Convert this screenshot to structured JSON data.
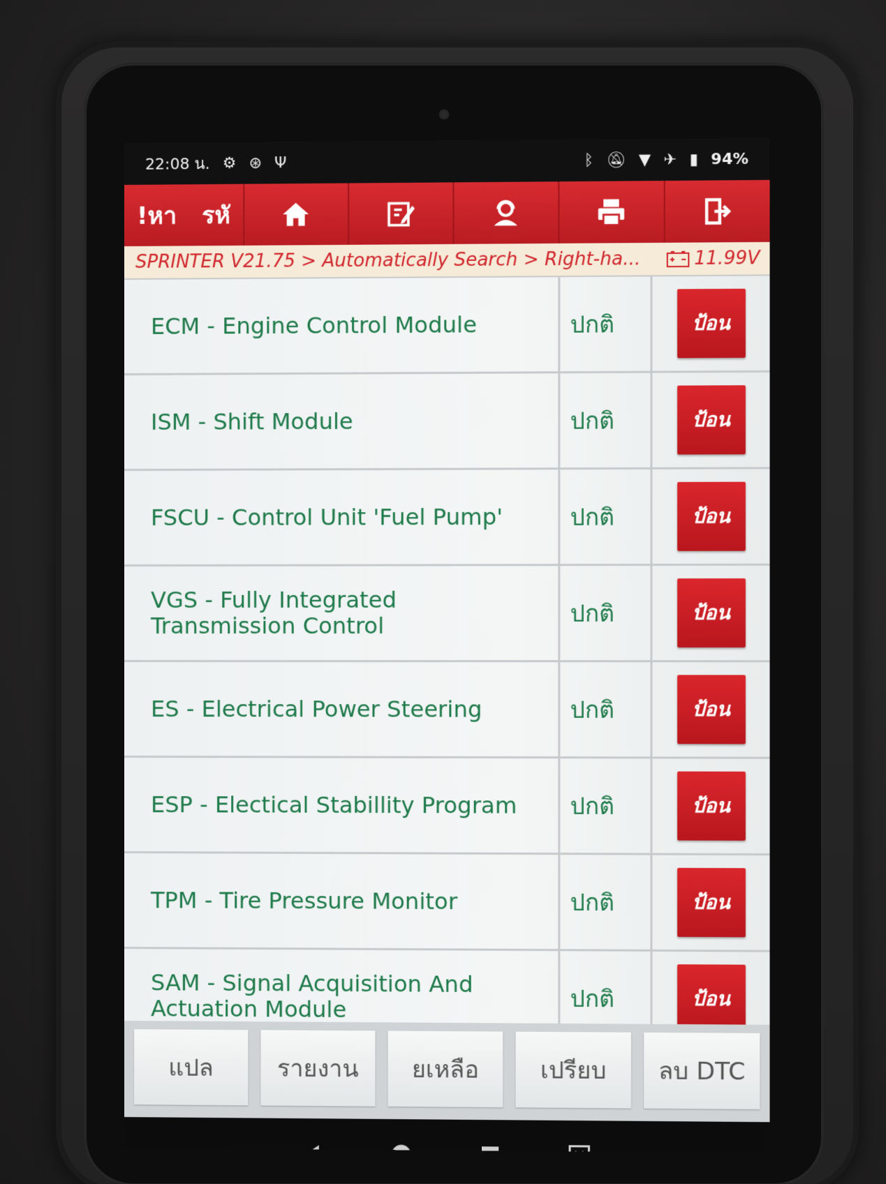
{
  "status_bar": {
    "time": "22:08 น.",
    "battery": "94%",
    "icons_left": [
      "gear-icon",
      "accessibility-icon",
      "usb-icon"
    ],
    "icons_right": [
      "bluetooth-icon",
      "mute-icon",
      "wifi-icon",
      "airplane-icon",
      "battery-icon"
    ]
  },
  "toolbar": {
    "search_label": "!หา",
    "code_label": "รหั",
    "buttons": [
      "home-icon",
      "edit-report-icon",
      "support-person-icon",
      "print-icon",
      "exit-icon"
    ],
    "accent_color": "#c8232a"
  },
  "breadcrumb": {
    "path": "SPRINTER V21.75 > Automatically Search > Right-ha...",
    "voltage": "11.99V"
  },
  "modules": [
    {
      "name": "ECM -  Engine Control Module",
      "status": "ปกติ",
      "action": "ป้อน"
    },
    {
      "name": "ISM -  Shift Module",
      "status": "ปกติ",
      "action": "ป้อน"
    },
    {
      "name": "FSCU -  Control Unit 'Fuel Pump'",
      "status": "ปกติ",
      "action": "ป้อน"
    },
    {
      "name": "VGS -  Fully Integrated Transmission Control",
      "status": "ปกติ",
      "action": "ป้อน"
    },
    {
      "name": "ES -  Electrical Power Steering",
      "status": "ปกติ",
      "action": "ป้อน"
    },
    {
      "name": "ESP -  Electical Stabillity Program",
      "status": "ปกติ",
      "action": "ป้อน"
    },
    {
      "name": "TPM -  Tire Pressure Monitor",
      "status": "ปกติ",
      "action": "ป้อน"
    },
    {
      "name": "SAM -  Signal Acquisition And Actuation Module",
      "status": "ปกติ",
      "action": "ป้อน"
    }
  ],
  "bottom_bar": {
    "translate": "แปล",
    "report": "รายงาน",
    "remaining": "ยเหลือ",
    "compare": "เปรียบ",
    "clear_dtc": "ลบ DTC"
  },
  "nav_bar": [
    "back-icon",
    "home-circle-icon",
    "recents-icon",
    "screenshot-icon"
  ]
}
